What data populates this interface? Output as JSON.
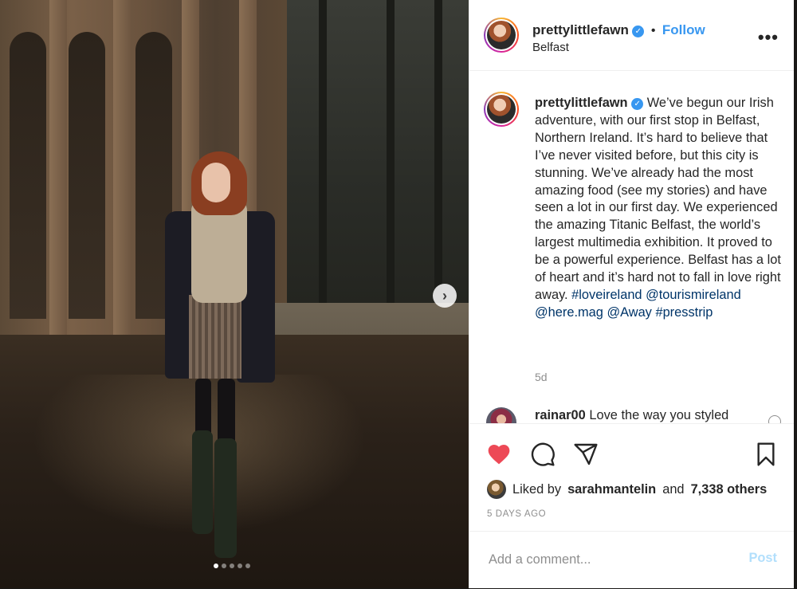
{
  "post": {
    "author": "prettylittlefawn",
    "verified": true,
    "follow_label": "Follow",
    "separator": "•",
    "location": "Belfast",
    "more_label": "•••",
    "caption": [
      {
        "text": "We’ve begun our Irish adventure, with our first stop in Belfast, Northern Ireland. It’s hard to believe that I’ve never visited before, but this city is stunning. We’ve already had the most amazing food (see my stories) and have seen a lot in our first day. We experienced the amazing Titanic Belfast, the world’s largest multimedia exhibition. It proved to be a powerful experience. Belfast has a lot of heart and it’s hard not to fall in love right away. "
      },
      {
        "text": "#loveireland"
      },
      {
        "text": "@tourismireland"
      },
      {
        "text": "@here.mag"
      },
      {
        "text": "@Away"
      },
      {
        "text": "#presstrip"
      }
    ],
    "time_ago": "5d",
    "carousel": {
      "total": 5,
      "active_index": 0
    },
    "next_arrow": "›"
  },
  "comments": [
    {
      "user": "rainar00",
      "text": "Love the way you styled"
    }
  ],
  "likes": {
    "prefix": "Liked by",
    "user": "sarahmantelin",
    "connector": "and",
    "others": "7,338 others"
  },
  "date_label": "5 DAYS AGO",
  "add_comment": {
    "placeholder": "Add a comment...",
    "post_label": "Post"
  },
  "colors": {
    "accent": "#3897f0",
    "like_red": "#ed4956",
    "hashtag": "#003569",
    "muted": "#8e8e8e"
  },
  "icons": [
    "heart-filled-icon",
    "comment-icon",
    "share-icon",
    "bookmark-icon",
    "verified-icon",
    "more-icon",
    "chevron-right-icon"
  ]
}
